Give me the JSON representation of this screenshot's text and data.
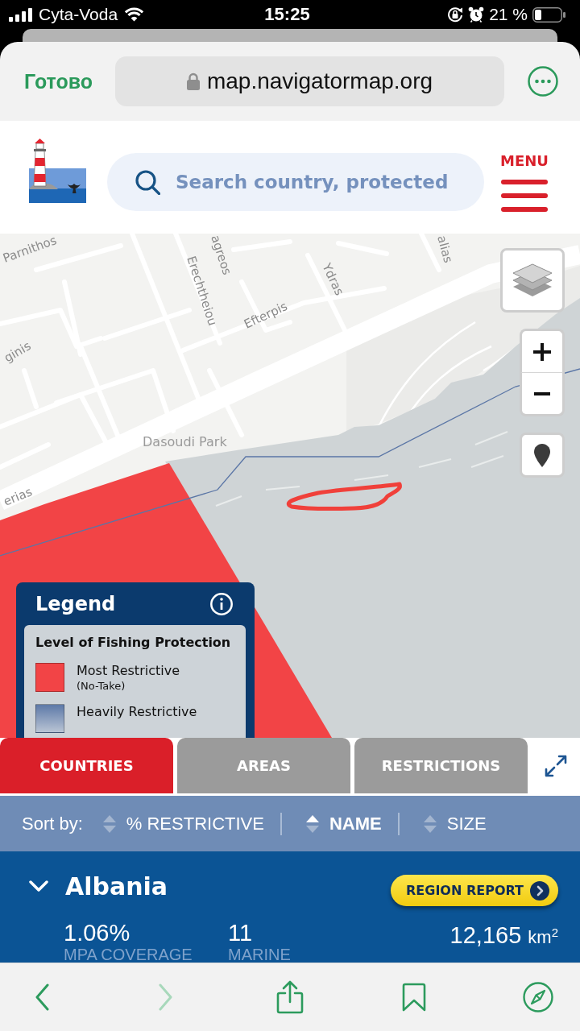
{
  "status_bar": {
    "carrier": "Cyta-Voda",
    "time": "15:25",
    "battery": "21 %"
  },
  "browser": {
    "done": "Готово",
    "url": "map.navigatormap.org"
  },
  "header": {
    "search": {
      "placeholder": "Search country, protected"
    },
    "menu": "MENU"
  },
  "map": {
    "labels": [
      {
        "text": "Parnithos",
        "kind": "street"
      },
      {
        "text": "agreos",
        "kind": "street"
      },
      {
        "text": "Erechtheiou",
        "kind": "street"
      },
      {
        "text": "Efterpis",
        "kind": "street"
      },
      {
        "text": "Ydras",
        "kind": "street"
      },
      {
        "text": "alias",
        "kind": "street"
      },
      {
        "text": "ginis",
        "kind": "street"
      },
      {
        "text": "Dasoudi Park",
        "kind": "park"
      },
      {
        "text": "erias",
        "kind": "street"
      }
    ],
    "legend": {
      "title": "Legend",
      "heading": "Level of Fishing Protection",
      "items": [
        {
          "label": "Most Restrictive",
          "note": "(No-Take)",
          "color": "#f24446"
        },
        {
          "label": "Heavily Restrictive",
          "color": "#5d79a8"
        }
      ]
    }
  },
  "tabs": [
    {
      "label": "COUNTRIES",
      "selected": true
    },
    {
      "label": "AREAS",
      "selected": false
    },
    {
      "label": "RESTRICTIONS",
      "selected": false
    }
  ],
  "sort": {
    "label": "Sort by:",
    "options": [
      {
        "label": "% RESTRICTIVE",
        "selected": false
      },
      {
        "label": "NAME",
        "selected": true
      },
      {
        "label": "SIZE",
        "selected": false
      }
    ]
  },
  "regions": [
    {
      "name": "Albania",
      "expanded": true,
      "button": "REGION REPORT",
      "stats": [
        {
          "value": "1.06%",
          "label": "MPA COVERAGE"
        },
        {
          "value": "11",
          "label": "MARINE"
        },
        {
          "value": "12,165",
          "unit": "km$^{2}$"
        }
      ]
    }
  ],
  "toolbar": [
    {
      "kind": "back",
      "disabled": false
    },
    {
      "kind": "forward",
      "disabled": true
    },
    {
      "kind": "share",
      "disabled": false
    },
    {
      "kind": "bookmarks",
      "disabled": false
    },
    {
      "kind": "compass",
      "disabled": false
    }
  ]
}
